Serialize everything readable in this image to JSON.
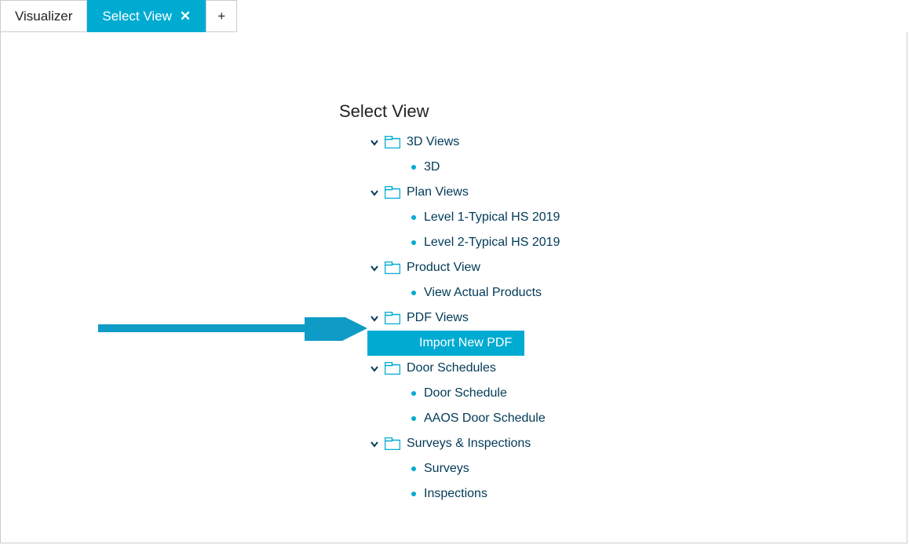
{
  "tabs": {
    "visualizer": "Visualizer",
    "active": "Select View",
    "add": "+"
  },
  "heading": "Select View",
  "accent_color": "#00abd2",
  "tree": {
    "folders": [
      {
        "label": "3D Views",
        "items": [
          {
            "label": "3D",
            "selected": false
          }
        ]
      },
      {
        "label": "Plan Views",
        "items": [
          {
            "label": "Level 1-Typical HS 2019",
            "selected": false
          },
          {
            "label": "Level 2-Typical HS 2019",
            "selected": false
          }
        ]
      },
      {
        "label": "Product View",
        "items": [
          {
            "label": "View Actual Products",
            "selected": false
          }
        ]
      },
      {
        "label": "PDF Views",
        "items": [
          {
            "label": "Import New PDF",
            "selected": true
          }
        ]
      },
      {
        "label": "Door Schedules",
        "items": [
          {
            "label": "Door Schedule",
            "selected": false
          },
          {
            "label": "AAOS Door Schedule",
            "selected": false
          }
        ]
      },
      {
        "label": "Surveys & Inspections",
        "items": [
          {
            "label": "Surveys",
            "selected": false
          },
          {
            "label": "Inspections",
            "selected": false
          }
        ]
      }
    ]
  }
}
